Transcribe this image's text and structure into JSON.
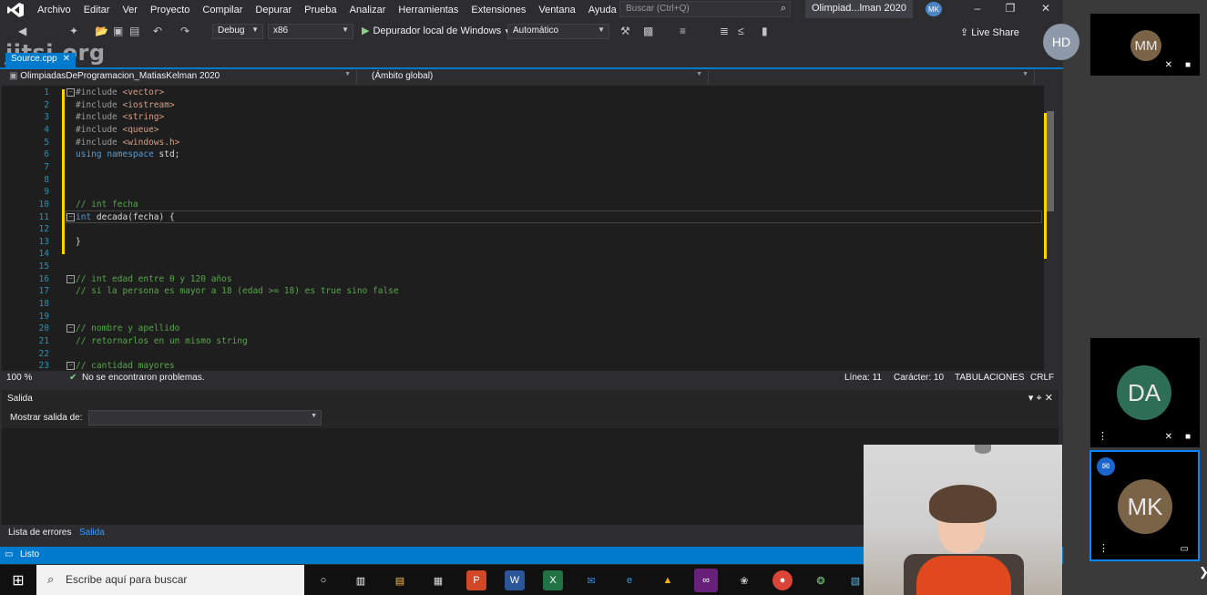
{
  "menu": [
    "Archivo",
    "Editar",
    "Ver",
    "Proyecto",
    "Compilar",
    "Depurar",
    "Prueba",
    "Analizar",
    "Herramientas",
    "Extensiones",
    "Ventana",
    "Ayuda"
  ],
  "search_placeholder": "Buscar (Ctrl+Q)",
  "window_title": "Olimpiad...lman 2020",
  "user_initials": "MK",
  "toolbar": {
    "config": "Debug",
    "platform": "x86",
    "run_label": "Depurador local de Windows",
    "run_mode": "Automático",
    "live_share": "Live Share"
  },
  "watermark": "jitsi.org",
  "doc_tab": "Source.cpp",
  "nav": {
    "project": "OlimpiadasDeProgramacion_MatiasKelman 2020",
    "scope": "(Ámbito global)"
  },
  "code": [
    {
      "n": "1",
      "t": "#include <vector>"
    },
    {
      "n": "2",
      "t": "#include <iostream>"
    },
    {
      "n": "3",
      "t": "#include <string>"
    },
    {
      "n": "4",
      "t": "#include <queue>"
    },
    {
      "n": "5",
      "t": "#include <windows.h>"
    },
    {
      "n": "6",
      "t": "using namespace std;"
    },
    {
      "n": "7",
      "t": ""
    },
    {
      "n": "8",
      "t": ""
    },
    {
      "n": "9",
      "t": ""
    },
    {
      "n": "10",
      "t": "// int fecha"
    },
    {
      "n": "11",
      "t": "int decada(fecha) {"
    },
    {
      "n": "12",
      "t": ""
    },
    {
      "n": "13",
      "t": "}"
    },
    {
      "n": "14",
      "t": ""
    },
    {
      "n": "15",
      "t": ""
    },
    {
      "n": "16",
      "t": "// int edad entre 0 y 120 años"
    },
    {
      "n": "17",
      "t": "// si la persona es mayor a 18 (edad >= 18) es true sino false"
    },
    {
      "n": "18",
      "t": ""
    },
    {
      "n": "19",
      "t": ""
    },
    {
      "n": "20",
      "t": "// nombre y apellido"
    },
    {
      "n": "21",
      "t": "// retornarlos en un mismo string"
    },
    {
      "n": "22",
      "t": ""
    },
    {
      "n": "23",
      "t": "// cantidad mayores"
    }
  ],
  "status_line": {
    "zoom": "100 %",
    "problems": "No se encontraron problemas.",
    "line": "Línea: 11",
    "char": "Carácter: 10",
    "tabs": "TABULACIONES",
    "eol": "CRLF"
  },
  "output": {
    "title": "Salida",
    "show_from": "Mostrar salida de:"
  },
  "bottom_tabs": [
    "Lista de errores",
    "Salida"
  ],
  "status": "Listo",
  "taskbar_search": "Escribe aquí para buscar",
  "participants": [
    {
      "initials": "HD",
      "color": "#8e9aa9"
    },
    {
      "initials": "MM",
      "color": "#7b6348"
    },
    {
      "initials": "DA",
      "color": "#2f6e56"
    },
    {
      "initials": "MK",
      "color": "#7b6348"
    }
  ]
}
